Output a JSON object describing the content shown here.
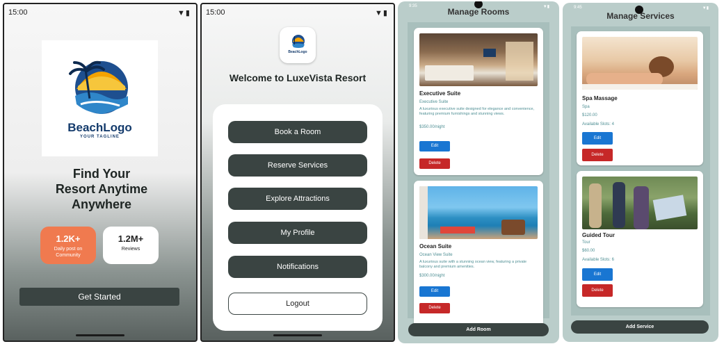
{
  "onboarding": {
    "status_time": "15:00",
    "status_icons": "wifi-icon battery-icon",
    "logo": {
      "brand": "BeachLogo",
      "tagline": "YOUR TAGLINE"
    },
    "headline": [
      "Find Your",
      "Resort Anytime",
      "Anywhere"
    ],
    "stat_posts": {
      "value": "1.2K+",
      "label_line1": "Daily post on",
      "label_line2": "Community"
    },
    "stat_reviews": {
      "value": "1.2M+",
      "label": "Reviews"
    },
    "get_started_label": "Get Started",
    "colors": {
      "accent_orange": "#f07a4f",
      "button_dark": "#3a4442"
    }
  },
  "menu": {
    "status_time": "15:00",
    "welcome": "Welcome to LuxeVista Resort",
    "buttons": [
      "Book a Room",
      "Reserve Services",
      "Explore Attractions",
      "My Profile",
      "Notifications"
    ],
    "logout_label": "Logout"
  },
  "manage_rooms": {
    "title": "Manage Rooms",
    "status_time": "9:35",
    "rooms": [
      {
        "name": "Executive Suite",
        "type": "Executive Suite",
        "description": "A luxurious executive suite designed for elegance and convenience, featuring premium furnishings and stunning views.",
        "price": "$350.00/night",
        "edit_label": "Edit",
        "delete_label": "Delete"
      },
      {
        "name": "Ocean Suite",
        "type": "Ocean View Suite",
        "description": "A luxurious suite with a stunning ocean view, featuring a private balcony and premium amenities.",
        "price": "$300.00/night",
        "edit_label": "Edit",
        "delete_label": "Delete"
      }
    ],
    "add_label": "Add Room"
  },
  "manage_services": {
    "title": "Manage Services",
    "status_time": "9:45",
    "services": [
      {
        "name": "Spa Massage",
        "category": "Spa",
        "price": "$120.00",
        "slots": "Available Slots: 4",
        "edit_label": "Edit",
        "delete_label": "Delete"
      },
      {
        "name": "Guided Tour",
        "category": "Tour",
        "price": "$60.00",
        "slots": "Available Slots: 6",
        "edit_label": "Edit",
        "delete_label": "Delete"
      }
    ],
    "add_label": "Add Service"
  }
}
